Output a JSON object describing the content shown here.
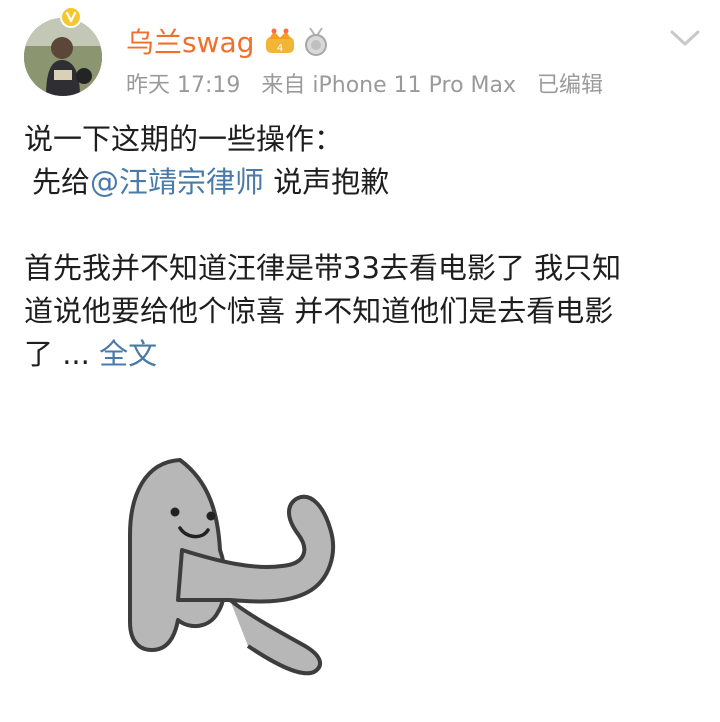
{
  "post": {
    "username": "乌兰swag",
    "time": "昨天 17:19",
    "source": "来自 iPhone 11 Pro Max",
    "edited": "已编辑",
    "line1": "说一下这期的一些操作：",
    "line2_prefix": "先给",
    "mention": "@汪靖宗律师",
    "line2_suffix": " 说声抱歉",
    "para2_line1": "首先我并不知道汪律是带33去看电影了 我只知",
    "para2_line2": "道说他要给他个惊喜 并不知道他们是去看电影",
    "para2_line3_prefix": "了 ... ",
    "read_more": "全文"
  },
  "icons": {
    "verify": "verified-badge-icon",
    "vip": "crown-vip-icon",
    "medal": "medal-icon",
    "chevron": "chevron-down-icon"
  },
  "colors": {
    "username": "#f06f2b",
    "link": "#4a7aa8",
    "meta": "#9a9a9a",
    "sticker": "#b7b7b7"
  }
}
